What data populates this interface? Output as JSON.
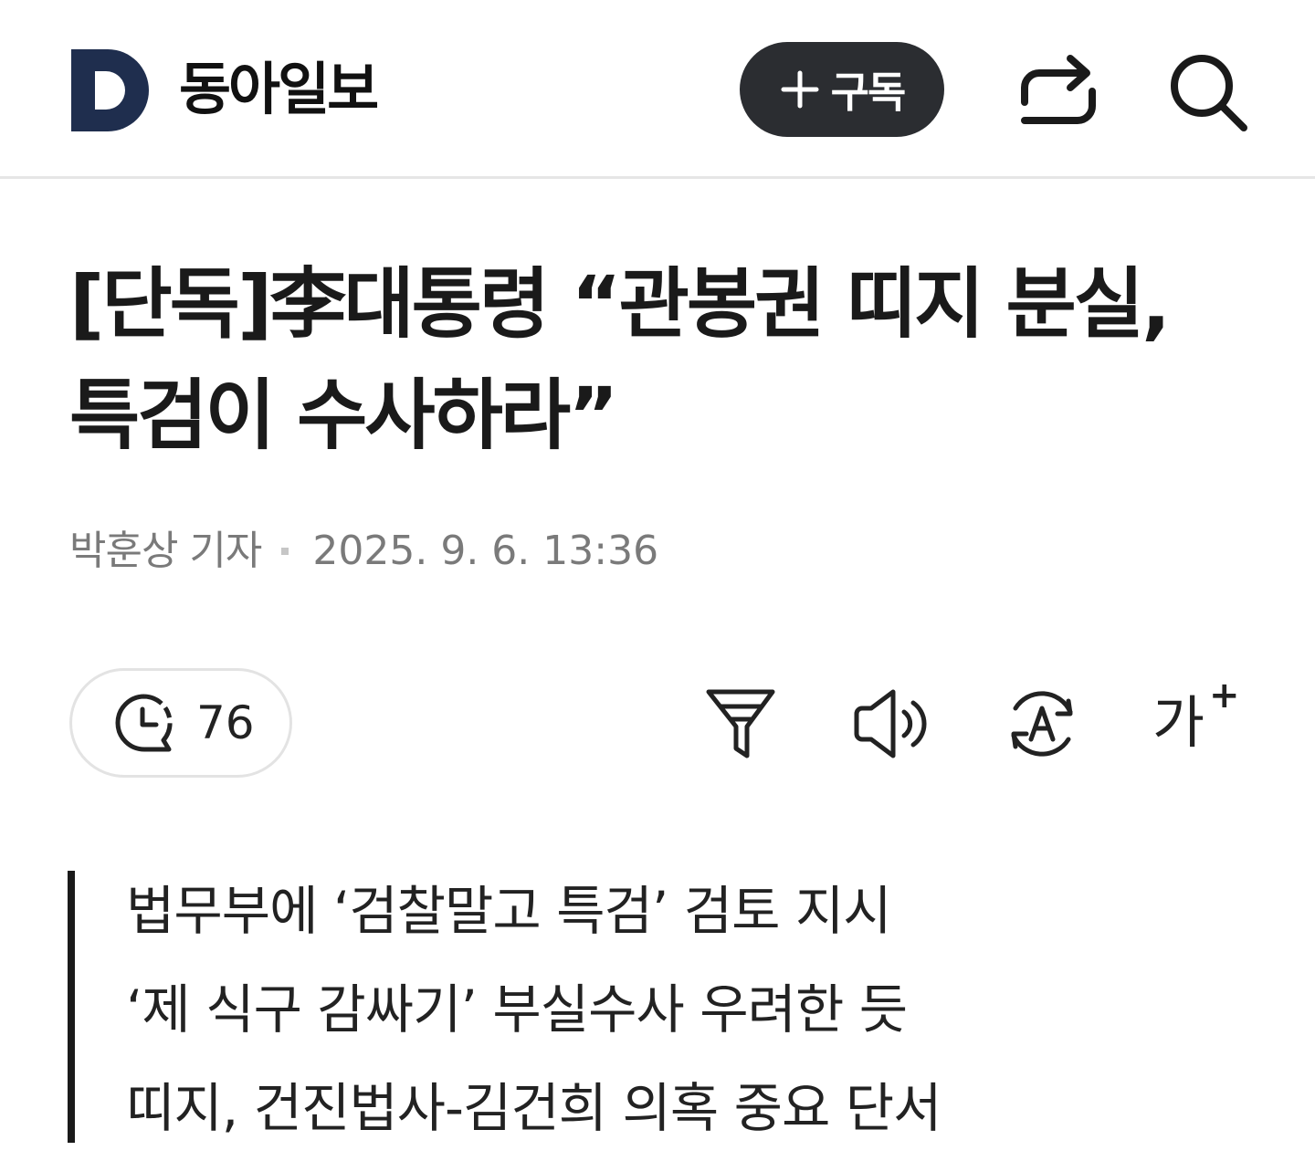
{
  "header": {
    "brand_name": "동아일보",
    "subscribe_label": "구독"
  },
  "article": {
    "headline": "[단독]李대통령 “관봉권 띠지 분실, 특검이 수사하라”",
    "reporter": "박훈상 기자",
    "published_at": "2025. 9. 6. 13:36",
    "comment_count": "76",
    "summary": [
      "법무부에 ‘검찰말고 특검’ 검토 지시",
      "‘제 식구 감싸기’ 부실수사 우려한 듯",
      "띠지, 건진법사-김건희 의혹 중요 단서"
    ]
  },
  "toolbar": {
    "font_size_glyph": "가",
    "font_size_plus": "+",
    "icons": [
      "comment-clock-icon",
      "filter-icon",
      "speaker-icon",
      "translate-icon",
      "font-size-icon"
    ]
  },
  "colors": {
    "logo": "#1f2e4e",
    "subscribe_bg": "#2b2d31",
    "text": "#1a1a1a",
    "meta": "#7a7a7a",
    "divider": "#e6e6e6"
  }
}
